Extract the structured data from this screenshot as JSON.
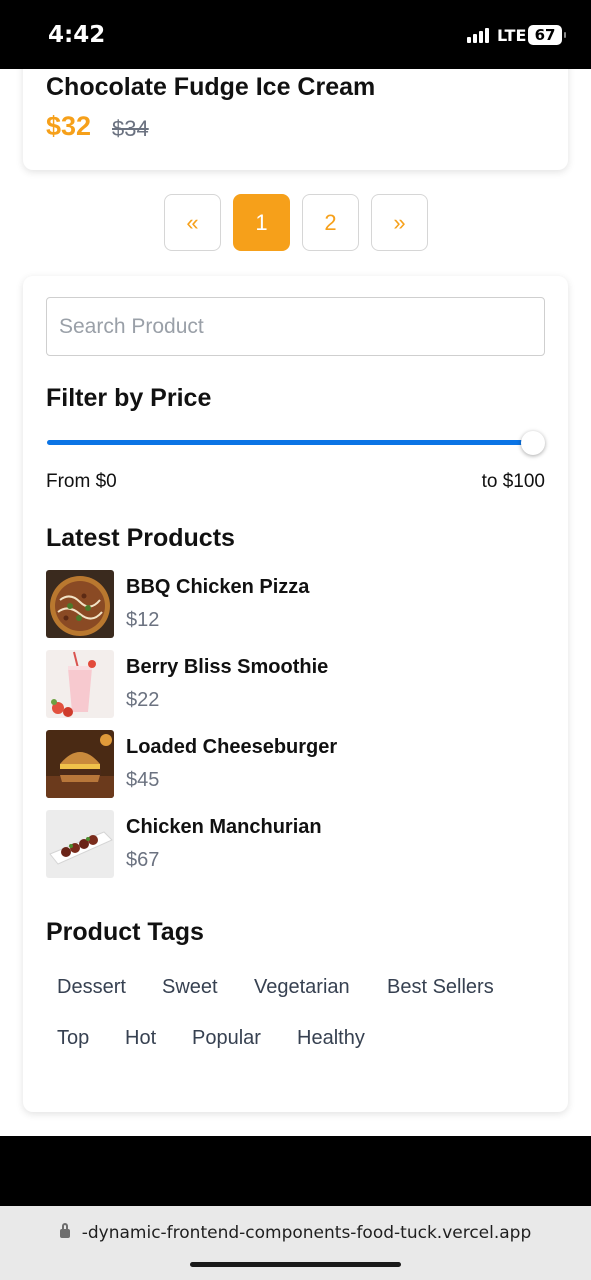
{
  "status_bar": {
    "time": "4:42",
    "network": "LTE",
    "battery": "67"
  },
  "product": {
    "title": "Chocolate Fudge Ice Cream",
    "price": "$32",
    "old_price": "$34"
  },
  "pagination": {
    "prev": "«",
    "pages": [
      "1",
      "2"
    ],
    "active_page": "1",
    "next": "»"
  },
  "search": {
    "placeholder": "Search Product",
    "value": ""
  },
  "price_filter": {
    "title": "Filter by Price",
    "from": "From $0",
    "to": "to $100",
    "slider_level": 1.0
  },
  "latest": {
    "title": "Latest Products",
    "items": [
      {
        "name": "BBQ Chicken Pizza",
        "price": "$12",
        "icon": "pizza-image"
      },
      {
        "name": "Berry Bliss Smoothie",
        "price": "$22",
        "icon": "smoothie-image"
      },
      {
        "name": "Loaded Cheeseburger",
        "price": "$45",
        "icon": "burger-image"
      },
      {
        "name": "Chicken Manchurian",
        "price": "$67",
        "icon": "manchurian-image"
      }
    ]
  },
  "tags": {
    "title": "Product Tags",
    "items": [
      "Dessert",
      "Sweet",
      "Vegetarian",
      "Best Sellers",
      "Top",
      "Hot",
      "Popular",
      "Healthy"
    ]
  },
  "browser": {
    "url": "-dynamic-frontend-components-food-tuck.vercel.app"
  },
  "colors": {
    "accent": "#f6a01a",
    "slider": "#0b74e5",
    "muted_text": "#6b7280"
  }
}
